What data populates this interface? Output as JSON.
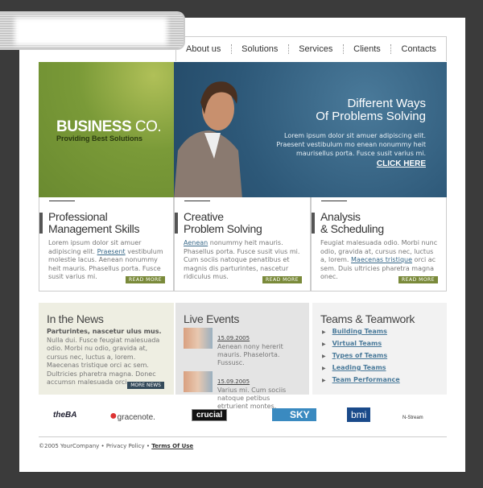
{
  "nav": [
    "About us",
    "Solutions",
    "Services",
    "Clients",
    "Contacts"
  ],
  "brand": {
    "name_bold": "BUSINESS",
    "name_light": " CO.",
    "tagline": "Providing Best Solutions"
  },
  "hero": {
    "title_line1": "Different Ways",
    "title_line2": "Of Problems Solving",
    "text": "Lorem ipsum dolor sit amuer adipiscing elit. Praesent vestibulum mo enean nonummy heit maurisellus porta. Fusce susit varius mi.",
    "cta": "CLICK HERE"
  },
  "features": [
    {
      "title1": "Professional",
      "title2": "Management Skills",
      "pre": "Lorem ipsum dolor sit amuer adipiscing elit. ",
      "link": "Praesent",
      "post": " vestibulum molestie lacus. Aenean nonummy heit mauris. Phasellus porta. Fusce susit varius mi.",
      "more": "READ MORE"
    },
    {
      "title1": "Creative",
      "title2": "Problem Solving",
      "pre": "",
      "link": "Aenean",
      "post": " nonummy heit mauris. Phasellus porta. Fusce susit vius mi. Cum sociis natoque penatibus et magnis dis parturintes, nascetur ridiculus mus.",
      "more": "READ MORE"
    },
    {
      "title1": "Analysis",
      "title2": "& Scheduling",
      "pre": "Feugiat malesuada odio. Morbi nunc odio, gravida at, cursus nec, luctus a, lorem. ",
      "link": "Maecenas tristique",
      "post": " orci ac sem. Duis ultricies pharetra magna onec.",
      "more": "READ MORE"
    }
  ],
  "news": {
    "title": "In the News",
    "lead": "Parturintes, nascetur ulus mus.",
    "text": "Nulla dui. Fusce feugiat malesuada odio. Morbi nu odio, gravida at, cursus nec, luctus a, lorem. Maecenas tristique orci ac sem. Dultricies pharetra magna. Donec accumsn malesuada orci.",
    "more": "MORE NEWS"
  },
  "events": {
    "title": "Live Events",
    "items": [
      {
        "date": "15.09.2005",
        "text": "Aenean nony hererit mauris. Phaselorta. Fussusc."
      },
      {
        "date": "15.09.2005",
        "text": "Varius mi. Cum sociis natoque petibus etrturient montes."
      }
    ]
  },
  "teams": {
    "title": "Teams & Teamwork",
    "items": [
      "Building Teams",
      "Virtual Teams",
      "Types of Teams",
      "Leading Teams",
      "Team Performance"
    ]
  },
  "logos": [
    "theBA",
    "gracenote.",
    "crucial",
    "SKY",
    "bmi",
    "N-Stream"
  ],
  "footer": {
    "copyright": "©2005 YourCompany",
    "privacy": "Privacy Policy",
    "terms": "Terms Of Use"
  }
}
